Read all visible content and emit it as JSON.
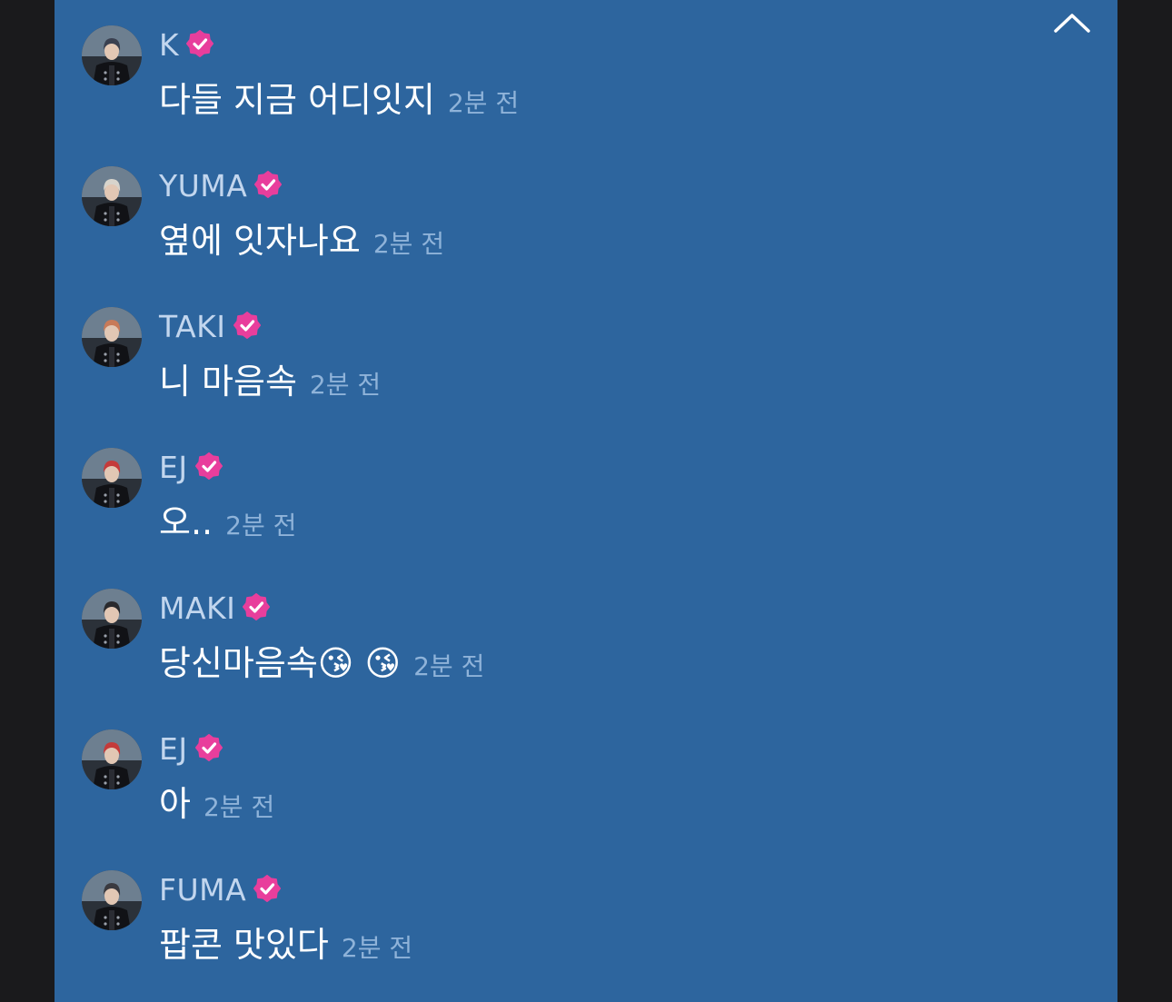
{
  "header": {
    "collapse_icon": "chevron-up-icon"
  },
  "colors": {
    "panel_bg": "#2d659e",
    "side_bg": "#1a1a1c",
    "badge": "#e83e9c",
    "name": "#c2d6ee",
    "time": "#8fb3d9",
    "message": "#ffffff"
  },
  "messages": [
    {
      "name": "K",
      "verified": true,
      "text": "다들 지금 어디잇지",
      "time": "2분 전",
      "hair": "#3a4050"
    },
    {
      "name": "YUMA",
      "verified": true,
      "text": "옆에 잇자나요",
      "time": "2분 전",
      "hair": "#d8d4cc"
    },
    {
      "name": "TAKI",
      "verified": true,
      "text": "니 마음속",
      "time": "2분 전",
      "hair": "#c87a58"
    },
    {
      "name": "EJ",
      "verified": true,
      "text": "오..",
      "time": "2분 전",
      "hair": "#c43a3a"
    },
    {
      "name": "MAKI",
      "verified": true,
      "text": "당신마음속😘 😘",
      "time": "2분 전",
      "hair": "#2a2a2e"
    },
    {
      "name": "EJ",
      "verified": true,
      "text": "아",
      "time": "2분 전",
      "hair": "#c43a3a"
    },
    {
      "name": "FUMA",
      "verified": true,
      "text": "팝콘 맛있다",
      "time": "2분 전",
      "hair": "#3a3a40"
    }
  ]
}
